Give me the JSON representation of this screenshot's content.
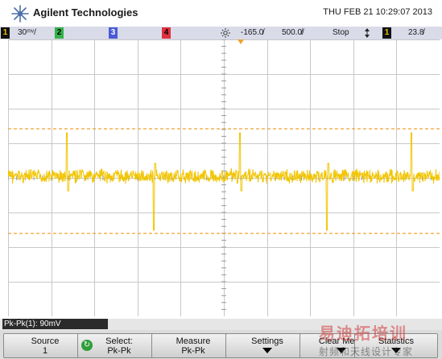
{
  "header": {
    "brand": "Agilent Technologies",
    "datetime": "THU FEB 21 10:29:07 2013",
    "logo_icon": "agilent-spark-logo"
  },
  "channel_bar": {
    "ch1_number": "1",
    "ch1_scale": "30​ᵐ/",
    "ch2_number": "2",
    "ch3_number": "3",
    "ch4_number": "4",
    "trigger_icon": "sun-icon",
    "time_offset": "-165.0̸",
    "time_scale": "500.0̸/",
    "run_state": "Stop",
    "trigger_slope_icon": "updown-arrow-icon",
    "trigger_channel": "1",
    "trigger_level": "23.8̸",
    "colors": {
      "ch1": "#f2c500",
      "ch2": "#33b24a",
      "ch3": "#4a5bd6",
      "ch4": "#e0303f"
    }
  },
  "display": {
    "trace_color": "#f2c500",
    "cursor_color": "#f0a030",
    "grid_color": "#c8c8c8",
    "trace_description": "noisy baseline with positive and negative spikes"
  },
  "readout": {
    "measurement": "Pk-Pk(1): 90mV"
  },
  "softkeys": [
    {
      "line1": "Source",
      "line2": "1",
      "icon": ""
    },
    {
      "line1": "Select:",
      "line2": "Pk-Pk",
      "icon": "rotate-icon"
    },
    {
      "line1": "Measure",
      "line2": "Pk-Pk",
      "icon": ""
    },
    {
      "line1": "Settings",
      "line2": "",
      "icon": "down-arrow-icon"
    },
    {
      "line1": "Clear Meas",
      "line2": "",
      "icon": "down-arrow-icon"
    },
    {
      "line1": "Statistics",
      "line2": "",
      "icon": "down-arrow-icon"
    }
  ],
  "watermark": {
    "line1": "易迪拓培训",
    "line2": "射频和天线设计专家"
  }
}
